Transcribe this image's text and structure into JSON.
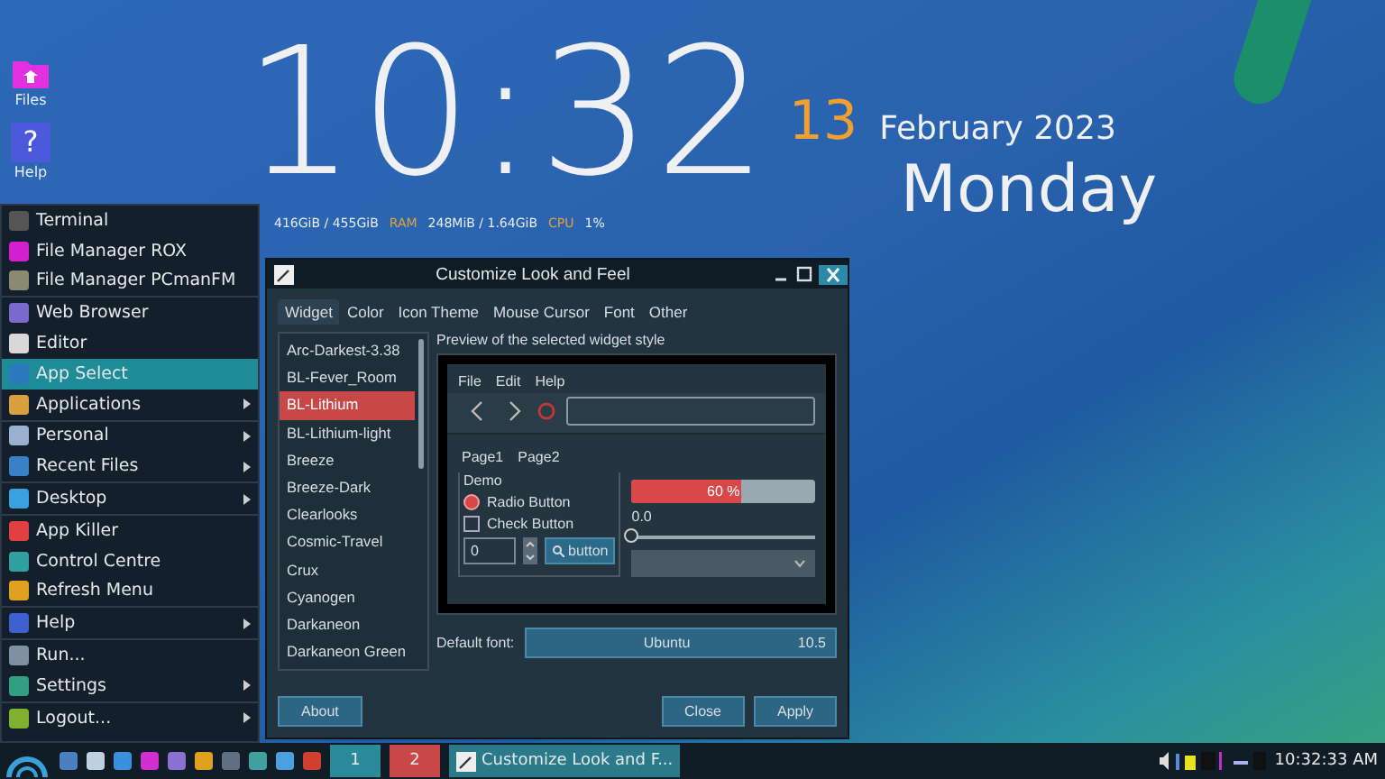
{
  "desktop_icons": [
    {
      "label": "Files",
      "kind": "folder"
    },
    {
      "label": "Help",
      "kind": "help",
      "glyph": "?"
    }
  ],
  "conky": {
    "time": "10:32",
    "day": "13",
    "month_year": "February 2023",
    "weekday": "Monday",
    "disk": "416GiB / 455GiB",
    "ram_label": "RAM",
    "ram": "248MiB / 1.64GiB",
    "cpu_label": "CPU",
    "cpu": "1%"
  },
  "menu": [
    [
      {
        "label": "Terminal",
        "submenu": false,
        "selected": false
      },
      {
        "label": "File Manager ROX",
        "submenu": false,
        "selected": false
      },
      {
        "label": "File Manager PCmanFM",
        "submenu": false,
        "selected": false
      }
    ],
    [
      {
        "label": "Web Browser",
        "submenu": false,
        "selected": false
      },
      {
        "label": "Editor",
        "submenu": false,
        "selected": false
      },
      {
        "label": "App Select",
        "submenu": false,
        "selected": true
      },
      {
        "label": "Applications",
        "submenu": true,
        "selected": false
      }
    ],
    [
      {
        "label": "Personal",
        "submenu": true,
        "selected": false
      },
      {
        "label": "Recent Files",
        "submenu": true,
        "selected": false
      }
    ],
    [
      {
        "label": "Desktop",
        "submenu": true,
        "selected": false
      }
    ],
    [
      {
        "label": "App Killer",
        "submenu": false,
        "selected": false
      },
      {
        "label": "Control Centre",
        "submenu": false,
        "selected": false
      },
      {
        "label": "Refresh Menu",
        "submenu": false,
        "selected": false
      }
    ],
    [
      {
        "label": "Help",
        "submenu": true,
        "selected": false
      }
    ],
    [
      {
        "label": "Run...",
        "submenu": false,
        "selected": false
      },
      {
        "label": "Settings",
        "submenu": true,
        "selected": false
      }
    ],
    [
      {
        "label": "Logout...",
        "submenu": true,
        "selected": false
      }
    ]
  ],
  "dialog": {
    "title": "Customize Look and Feel",
    "tabs": [
      {
        "label": "Widget",
        "selected": true
      },
      {
        "label": "Color",
        "selected": false
      },
      {
        "label": "Icon Theme",
        "selected": false
      },
      {
        "label": "Mouse Cursor",
        "selected": false
      },
      {
        "label": "Font",
        "selected": false
      },
      {
        "label": "Other",
        "selected": false
      }
    ],
    "themes": [
      {
        "label": "Arc-Darkest-3.38",
        "selected": false
      },
      {
        "label": "BL-Fever_Room",
        "selected": false
      },
      {
        "label": "BL-Lithium",
        "selected": true
      },
      {
        "label": "BL-Lithium-light",
        "selected": false
      },
      {
        "label": "Breeze",
        "selected": false
      },
      {
        "label": "Breeze-Dark",
        "selected": false
      },
      {
        "label": "Clearlooks",
        "selected": false
      },
      {
        "label": "Cosmic-Travel",
        "selected": false
      },
      {
        "label": "Crux",
        "selected": false
      },
      {
        "label": "Cyanogen",
        "selected": false
      },
      {
        "label": "Darkaneon",
        "selected": false
      },
      {
        "label": "Darkaneon Green",
        "selected": false
      }
    ],
    "preview_caption": "Preview of the selected widget style",
    "preview": {
      "menu": [
        "File",
        "Edit",
        "Help"
      ],
      "pages": [
        "Page1",
        "Page2"
      ],
      "group_label": "Demo",
      "radio": {
        "label": "Radio Button",
        "checked": true
      },
      "check": {
        "label": "Check Button",
        "checked": false
      },
      "spin_value": "0",
      "button": "button",
      "progress": {
        "level": 0.6,
        "text": "60 %"
      },
      "scale_value": "0.0",
      "slider": {
        "level": 0
      }
    },
    "font_label": "Default font:",
    "font_name": "Ubuntu",
    "font_size": "10.5",
    "buttons": [
      "About",
      "Close",
      "Apply"
    ]
  },
  "taskbar": {
    "workspaces": [
      {
        "label": "1",
        "selected": false
      },
      {
        "label": "2",
        "selected": true
      }
    ],
    "task": "Customize Look and F...",
    "clock": "10:32:33 AM"
  }
}
